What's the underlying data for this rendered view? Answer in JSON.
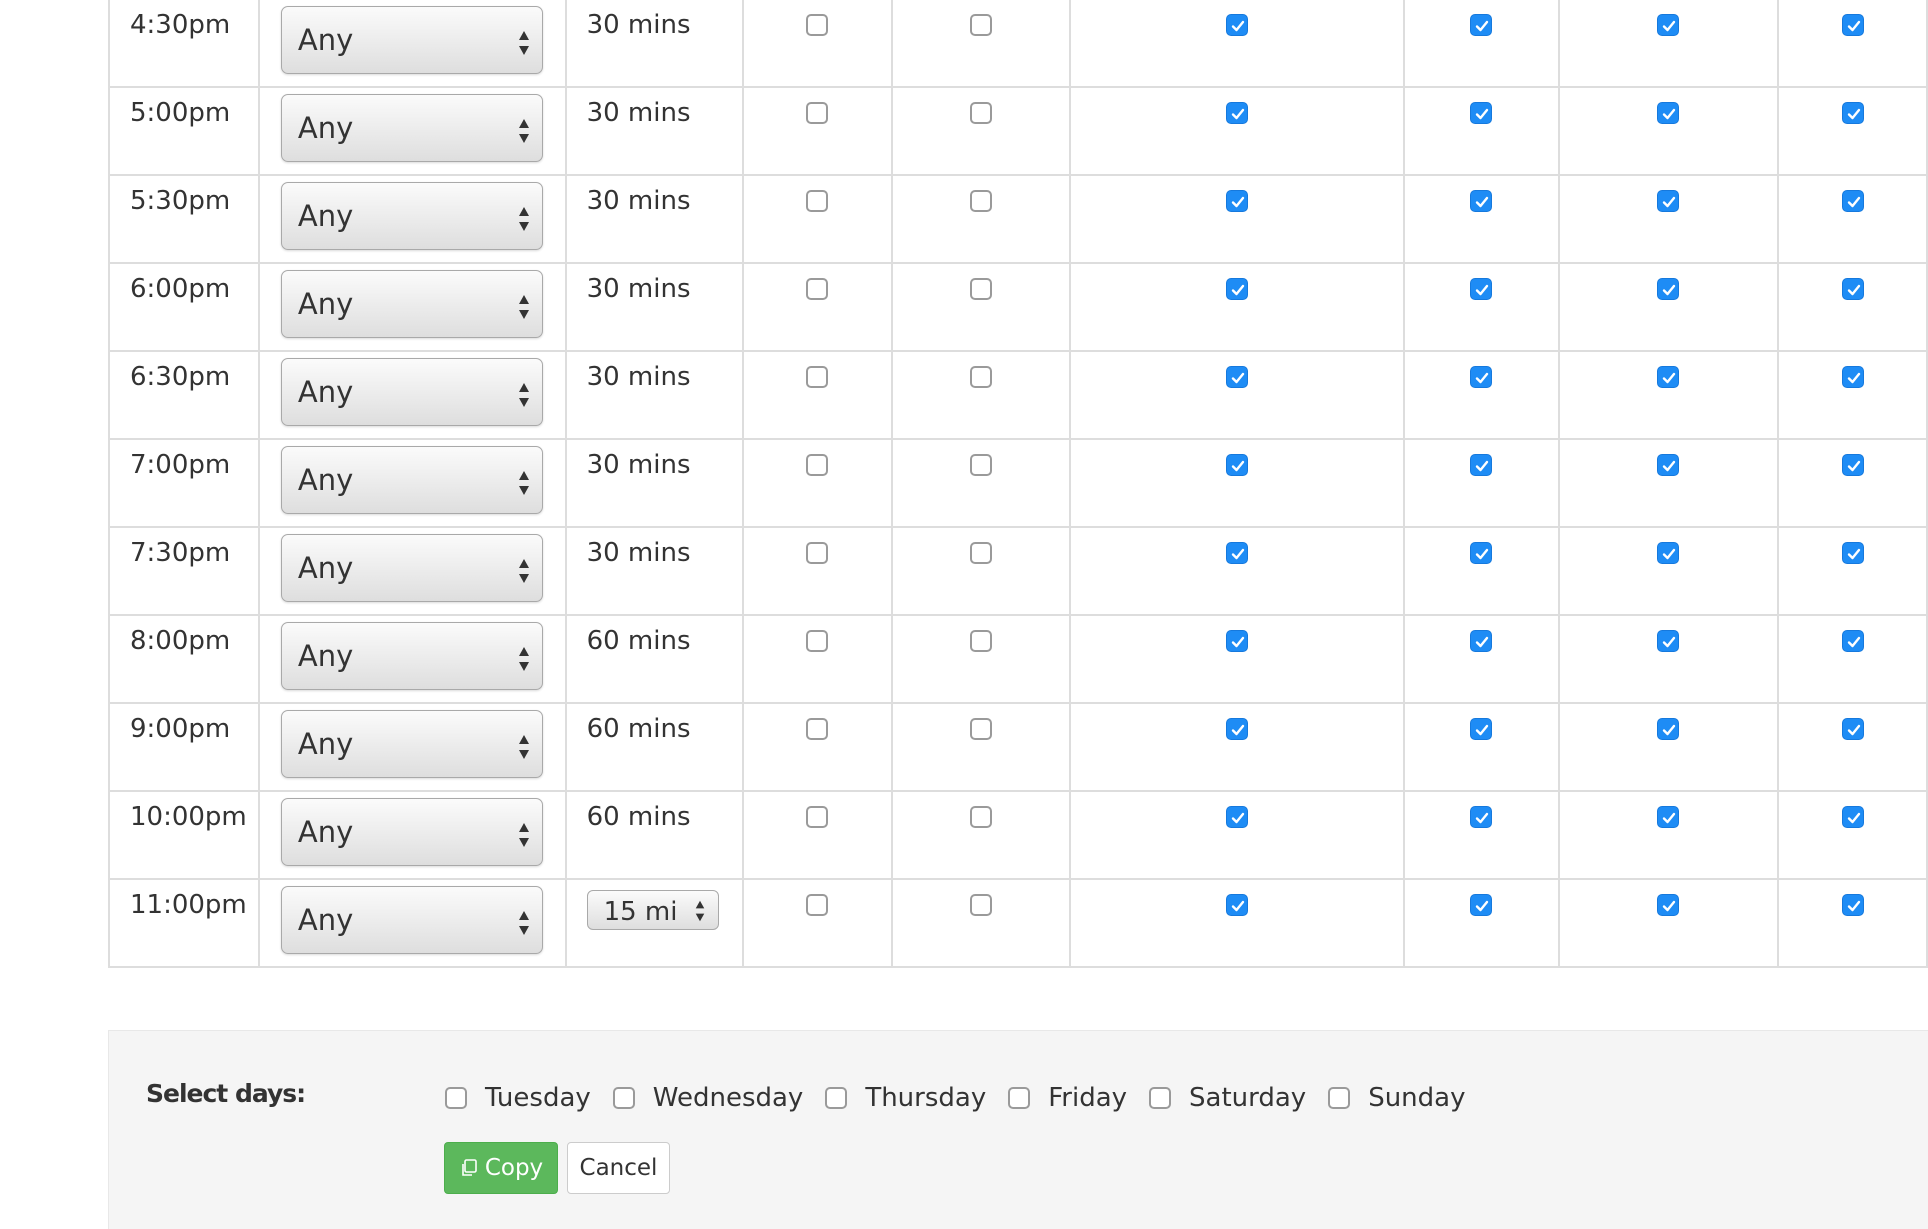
{
  "columns": {
    "checkbox_columns": 6
  },
  "rows": [
    {
      "time": "4:30pm",
      "type": "Any",
      "duration": "30 mins",
      "checks": [
        false,
        false,
        true,
        true,
        true,
        true
      ]
    },
    {
      "time": "5:00pm",
      "type": "Any",
      "duration": "30 mins",
      "checks": [
        false,
        false,
        true,
        true,
        true,
        true
      ]
    },
    {
      "time": "5:30pm",
      "type": "Any",
      "duration": "30 mins",
      "checks": [
        false,
        false,
        true,
        true,
        true,
        true
      ]
    },
    {
      "time": "6:00pm",
      "type": "Any",
      "duration": "30 mins",
      "checks": [
        false,
        false,
        true,
        true,
        true,
        true
      ]
    },
    {
      "time": "6:30pm",
      "type": "Any",
      "duration": "30 mins",
      "checks": [
        false,
        false,
        true,
        true,
        true,
        true
      ]
    },
    {
      "time": "7:00pm",
      "type": "Any",
      "duration": "30 mins",
      "checks": [
        false,
        false,
        true,
        true,
        true,
        true
      ]
    },
    {
      "time": "7:30pm",
      "type": "Any",
      "duration": "30 mins",
      "checks": [
        false,
        false,
        true,
        true,
        true,
        true
      ]
    },
    {
      "time": "8:00pm",
      "type": "Any",
      "duration": "60 mins",
      "checks": [
        false,
        false,
        true,
        true,
        true,
        true
      ]
    },
    {
      "time": "9:00pm",
      "type": "Any",
      "duration": "60 mins",
      "checks": [
        false,
        false,
        true,
        true,
        true,
        true
      ]
    },
    {
      "time": "10:00pm",
      "type": "Any",
      "duration": "60 mins",
      "checks": [
        false,
        false,
        true,
        true,
        true,
        true
      ]
    },
    {
      "time": "11:00pm",
      "type": "Any",
      "duration_select": "15 mi",
      "checks": [
        false,
        false,
        true,
        true,
        true,
        true
      ]
    }
  ],
  "copy_panel": {
    "label": "Select days:",
    "days": [
      {
        "label": "Tuesday",
        "checked": false
      },
      {
        "label": "Wednesday",
        "checked": false
      },
      {
        "label": "Thursday",
        "checked": false
      },
      {
        "label": "Friday",
        "checked": false
      },
      {
        "label": "Saturday",
        "checked": false
      },
      {
        "label": "Sunday",
        "checked": false
      }
    ],
    "copy_label": "Copy",
    "cancel_label": "Cancel"
  },
  "colors": {
    "checkbox_checked": "#1e8cf5",
    "copy_button": "#5cb85c",
    "panel_background": "#f5f5f5",
    "grid_border": "#dddddd"
  },
  "icons": {
    "select_arrows": "up-down-arrows-icon",
    "checkmark": "checkmark-icon",
    "copy": "copy-icon"
  }
}
